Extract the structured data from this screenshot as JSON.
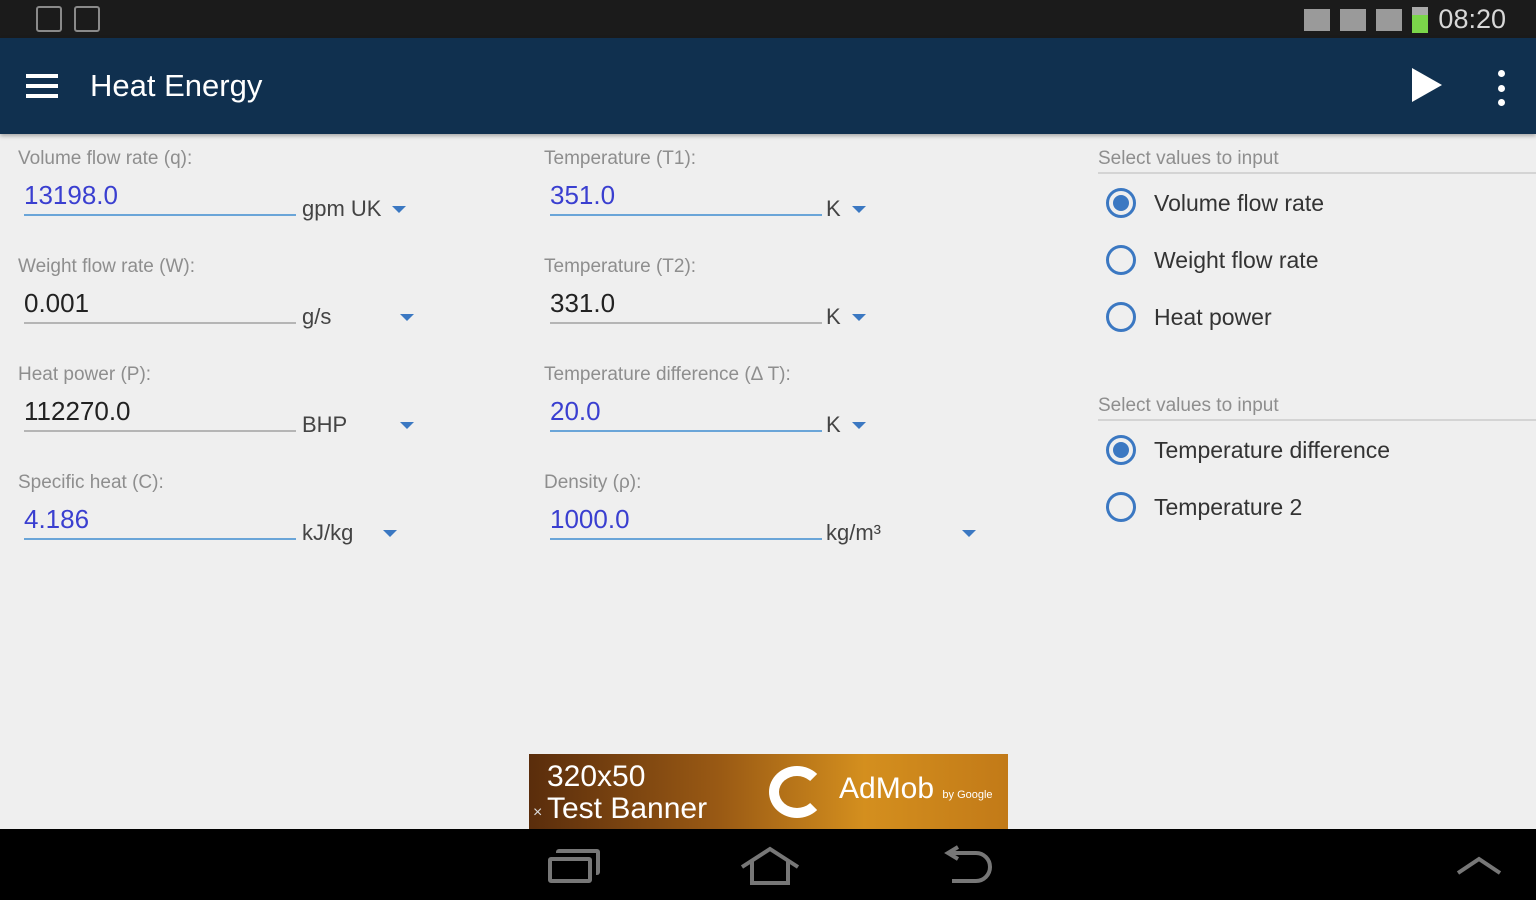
{
  "status": {
    "time": "08:20"
  },
  "app": {
    "title": "Heat Energy"
  },
  "left_fields": [
    {
      "label": "Volume flow rate (q):",
      "value": "13198.0",
      "unit": "gpm UK",
      "highlighted": true
    },
    {
      "label": "Weight flow rate (W):",
      "value": "0.001",
      "unit": "g/s",
      "highlighted": false
    },
    {
      "label": "Heat power (P):",
      "value": "112270.0",
      "unit": "BHP",
      "highlighted": false
    },
    {
      "label": "Specific heat (C):",
      "value": "4.186",
      "unit": "kJ/kg",
      "highlighted": true
    }
  ],
  "mid_fields": [
    {
      "label": "Temperature (T1):",
      "value": "351.0",
      "unit": "K",
      "highlighted": true
    },
    {
      "label": "Temperature (T2):",
      "value": "331.0",
      "unit": "K",
      "highlighted": false
    },
    {
      "label": "Temperature difference (Δ T):",
      "value": "20.0",
      "unit": "K",
      "highlighted": true
    },
    {
      "label": "Density (ρ):",
      "value": "1000.0",
      "unit": "kg/m³",
      "highlighted": true
    }
  ],
  "group1": {
    "label": "Select values to input",
    "options": [
      {
        "label": "Volume flow rate",
        "selected": true
      },
      {
        "label": "Weight flow rate",
        "selected": false
      },
      {
        "label": "Heat power",
        "selected": false
      }
    ]
  },
  "group2": {
    "label": "Select values to input",
    "options": [
      {
        "label": "Temperature difference",
        "selected": true
      },
      {
        "label": "Temperature 2",
        "selected": false
      }
    ]
  },
  "ad": {
    "line1": "320x50",
    "line2": "Test Banner",
    "close": "×",
    "brand": "AdMob",
    "brand_small": "by Google"
  },
  "colors": {
    "app_bar": "#10304f",
    "accent": "#3b78c2",
    "value_highlight": "#3a3fd0"
  }
}
